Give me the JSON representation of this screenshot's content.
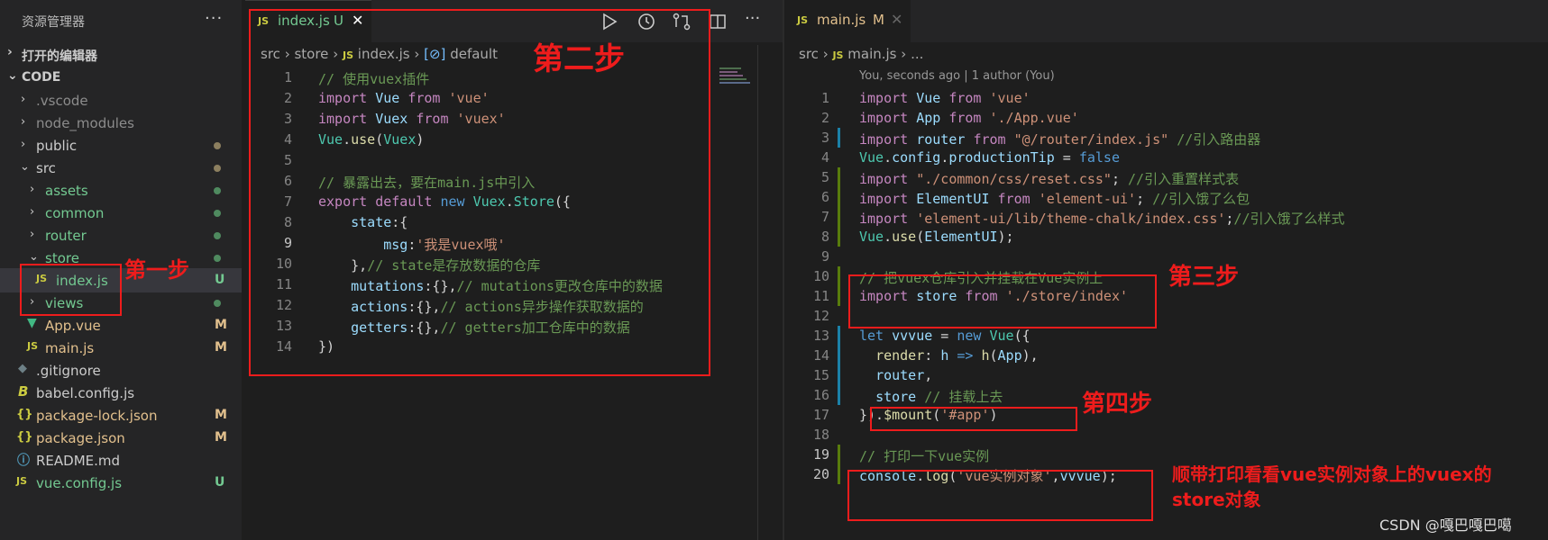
{
  "colors": {
    "accent_red": "#ee1c1c",
    "modified": "#e2c08d",
    "untracked": "#73c991",
    "js_yellow": "#cbcb41",
    "vue_green": "#41b883"
  },
  "sidebar": {
    "title": "资源管理器",
    "more": "···",
    "open_editors": "打开的编辑器",
    "workspace": "CODE",
    "items": [
      {
        "name": ".vscode"
      },
      {
        "name": "node_modules"
      },
      {
        "name": "public"
      },
      {
        "name": "src"
      },
      {
        "name": "assets"
      },
      {
        "name": "common"
      },
      {
        "name": "router"
      },
      {
        "name": "store"
      },
      {
        "name": "index.js",
        "status": "U",
        "icon": "JS"
      },
      {
        "name": "views"
      },
      {
        "name": "App.vue",
        "status": "M"
      },
      {
        "name": "main.js",
        "status": "M",
        "icon": "JS"
      },
      {
        "name": ".gitignore"
      },
      {
        "name": "babel.config.js"
      },
      {
        "name": "package-lock.json",
        "status": "M",
        "icon": "{}"
      },
      {
        "name": "package.json",
        "status": "M",
        "icon": "{}"
      },
      {
        "name": "README.md"
      },
      {
        "name": "vue.config.js",
        "status": "U",
        "icon": "JS"
      }
    ]
  },
  "left_editor": {
    "tab": {
      "icon": "JS",
      "name": "index.js",
      "status": "U",
      "close": "✕"
    },
    "breadcrumb": {
      "a": "src",
      "b": "store",
      "c_icon": "JS",
      "c": "index.js",
      "d": "default"
    },
    "lines": [
      "// 使用vuex插件",
      "import Vue from 'vue'",
      "import Vuex from 'vuex'",
      "Vue.use(Vuex)",
      "",
      "// 暴露出去，要在main.js中引入",
      "export default new Vuex.Store({",
      "    state:{",
      "        msg:'我是vuex哦'",
      "    },// state是存放数据的仓库",
      "    mutations:{},// mutations更改仓库中的数据",
      "    actions:{},// actions异步操作获取数据的",
      "    getters:{},// getters加工仓库中的数据",
      "})"
    ]
  },
  "right_editor": {
    "tab": {
      "icon": "JS",
      "name": "main.js",
      "status": "M",
      "close": "✕"
    },
    "breadcrumb": {
      "a": "src",
      "b_icon": "JS",
      "b": "main.js",
      "c": "..."
    },
    "blame": "You, seconds ago | 1 author (You)",
    "lines": [
      "import Vue from 'vue'",
      "import App from './App.vue'",
      "import router from \"@/router/index.js\" //引入路由器",
      "Vue.config.productionTip = false",
      "import \"./common/css/reset.css\"; //引入重置样式表",
      "import ElementUI from 'element-ui'; //引入饿了么包",
      "import 'element-ui/lib/theme-chalk/index.css';//引入饿了么样式",
      "Vue.use(ElementUI);",
      "",
      "// 把vuex仓库引入并挂载在Vue实例上",
      "import store from './store/index'",
      "",
      "let vvvue = new Vue({",
      "  render: h => h(App),",
      "  router,",
      "  store // 挂载上去",
      "}).$mount('#app')",
      "",
      "// 打印一下vue实例",
      "console.log('vue实例对象',vvvue);"
    ]
  },
  "annotations": {
    "step1": "第一步",
    "step2": "第二步",
    "step3": "第三步",
    "step4": "第四步",
    "note": "顺带打印看看vue实例对象上的vuex的store对象",
    "watermark": "CSDN @嘎巴嘎巴噶"
  }
}
